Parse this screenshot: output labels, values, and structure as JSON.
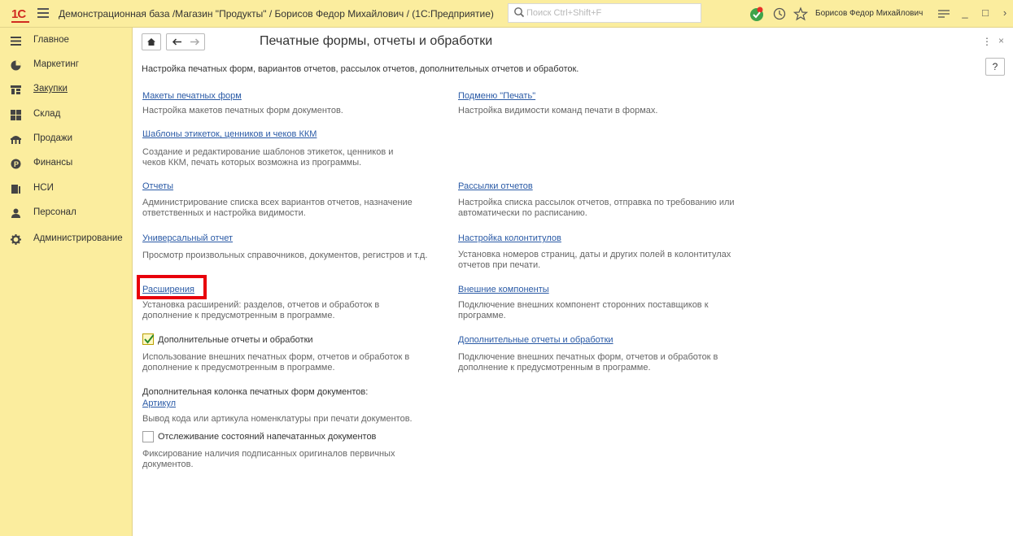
{
  "titlebar": {
    "logo": "1С",
    "title": "Демонстрационная база /Магазин \"Продукты\" / Борисов Федор Михайлович /  (1С:Предприятие)",
    "search_placeholder": "Поиск Ctrl+Shift+F",
    "user": "Борисов Федор Михайлович",
    "icons": [
      "notifications-icon",
      "history-icon",
      "favorites-star-icon",
      "settings-icon",
      "minimize-icon",
      "maximize-icon",
      "close-icon"
    ],
    "minimize": "_",
    "maximize": "□"
  },
  "sidebar": {
    "items": [
      {
        "label": "Главное",
        "icon": "menu-icon"
      },
      {
        "label": "Маркетинг",
        "icon": "marketing-icon"
      },
      {
        "label": "Закупки",
        "icon": "purchases-icon",
        "active": true
      },
      {
        "label": "Склад",
        "icon": "warehouse-icon"
      },
      {
        "label": "Продажи",
        "icon": "sales-icon"
      },
      {
        "label": "Финансы",
        "icon": "finance-icon"
      },
      {
        "label": "НСИ",
        "icon": "nsi-icon"
      },
      {
        "label": "Персонал",
        "icon": "personnel-icon"
      },
      {
        "label": "Администрирование",
        "icon": "gear-icon"
      }
    ]
  },
  "main": {
    "title": "Печатные формы, отчеты и обработки",
    "description": "Настройка печатных форм, вариантов отчетов, рассылок отчетов, дополнительных отчетов и обработок.",
    "help": "?",
    "more": "⋮",
    "close": "×",
    "left": {
      "print_forms": {
        "link": "Макеты печатных форм",
        "desc": "Настройка макетов печатных форм документов."
      },
      "labels": {
        "link": "Шаблоны этикеток, ценников и чеков ККМ",
        "desc1": "Создание и редактирование шаблонов этикеток, ценников и",
        "desc2": "чеков ККМ, печать которых возможна из программы."
      },
      "reports": {
        "link": "Отчеты",
        "desc1": "Администрирование списка всех вариантов отчетов, назначение",
        "desc2": "ответственных и настройка видимости."
      },
      "universal": {
        "link": "Универсальный отчет",
        "desc": "Просмотр произвольных справочников, документов, регистров и т.д."
      },
      "extensions": {
        "link": "Расширения",
        "desc1": "Установка расширений: разделов, отчетов и обработок в",
        "desc2": "дополнение к предусмотренным в программе."
      },
      "additional": {
        "label": "Дополнительные отчеты и обработки",
        "checked": true,
        "desc1": "Использование внешних печатных форм, отчетов и обработок в",
        "desc2": "дополнение к предусмотренным в программе."
      },
      "extra_column": {
        "label": "Дополнительная колонка печатных форм документов:",
        "link": "Артикул",
        "desc": "Вывод кода или артикула номенклатуры при печати документов."
      },
      "tracking": {
        "label": "Отслеживание состояний напечатанных документов",
        "checked": false,
        "desc1": "Фиксирование наличия подписанных оригиналов первичных",
        "desc2": "документов."
      }
    },
    "right": {
      "print_submenu": {
        "link": "Подменю \"Печать\"",
        "desc": "Настройка видимости команд печати в формах."
      },
      "mailing": {
        "link": "Рассылки отчетов",
        "desc1": "Настройка списка рассылок отчетов, отправка по требованию или",
        "desc2": "автоматически по расписанию."
      },
      "headers": {
        "link": "Настройка колонтитулов",
        "desc1": "Установка номеров страниц, даты и других полей в колонтитулах",
        "desc2": "отчетов при печати."
      },
      "components": {
        "link": "Внешние компоненты",
        "desc1": "Подключение внешних компонент сторонних поставщиков к",
        "desc2": "программе."
      },
      "additional": {
        "link": "Дополнительные отчеты и обработки",
        "desc1": "Подключение внешних печатных форм, отчетов и обработок в",
        "desc2": "дополнение к предусмотренным в программе."
      }
    }
  },
  "colors": {
    "panel": "#fbed9e",
    "link": "#2a5aa6",
    "highlight": "#e8000b"
  }
}
